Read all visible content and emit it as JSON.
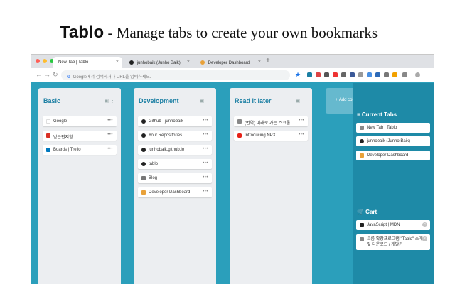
{
  "headline": {
    "brand": "Tablo",
    "tagline": " - Manage tabs to create your own bookmarks"
  },
  "browser": {
    "tabs": [
      {
        "label": "New Tab | Tablo",
        "active": true
      },
      {
        "label": "junhobaik (Junho Baik)",
        "active": false
      },
      {
        "label": "Developer Dashboard",
        "active": false
      }
    ],
    "new_tab": "+",
    "close_glyph": "×",
    "nav": {
      "back": "←",
      "forward": "→",
      "reload": "↻"
    },
    "omnibox": {
      "g": "G",
      "placeholder": "Google에서 검색하거나 URL을 입력하세요."
    },
    "star": "★"
  },
  "columns": [
    {
      "title": "Basic",
      "cards": [
        {
          "label": "Google",
          "icon": "google-icon"
        },
        {
          "label": "받은편지함",
          "icon": "gmail-icon"
        },
        {
          "label": "Boards | Trello",
          "icon": "trello-icon"
        }
      ]
    },
    {
      "title": "Development",
      "cards": [
        {
          "label": "Github - junhobaik",
          "icon": "github-icon"
        },
        {
          "label": "Your Repositories",
          "icon": "github-icon"
        },
        {
          "label": "junhobaik.github.io",
          "icon": "github-icon"
        },
        {
          "label": "tablo",
          "icon": "github-icon"
        },
        {
          "label": "Blog",
          "icon": "blog-icon"
        },
        {
          "label": "Developer Dashboard",
          "icon": "chrome-icon"
        }
      ]
    },
    {
      "title": "Read it later",
      "cards": [
        {
          "label": "(번역) 미래로 가는 스크롤",
          "icon": "doc-icon"
        },
        {
          "label": "Introducing NPX",
          "icon": "youtube-icon"
        }
      ]
    }
  ],
  "card_more": "•••",
  "column_icons": "▣ ⋮",
  "add_column": "+ Add col",
  "sidebar": {
    "current_tabs_title": "≡ Current Tabs",
    "current_tabs": [
      {
        "label": "New Tab | Tablo",
        "icon": "doc-icon"
      },
      {
        "label": "junhobaik (Junho Baik)",
        "icon": "github-icon"
      },
      {
        "label": "Developer Dashboard",
        "icon": "chrome-icon"
      }
    ],
    "cart_title": "🛒 Cart",
    "cart": [
      {
        "label": "JavaScript | MDN",
        "icon": "mdn-icon"
      },
      {
        "label": "크롬 확장프로그램 \"Tablo\" 소개 및 다운로드 / 개발기",
        "icon": "doc-icon"
      }
    ],
    "cart_close": "×"
  },
  "colors": {
    "board": "#2b9fbb",
    "sidepanel": "#1e8aa7",
    "column_title": "#1b7fa3"
  }
}
